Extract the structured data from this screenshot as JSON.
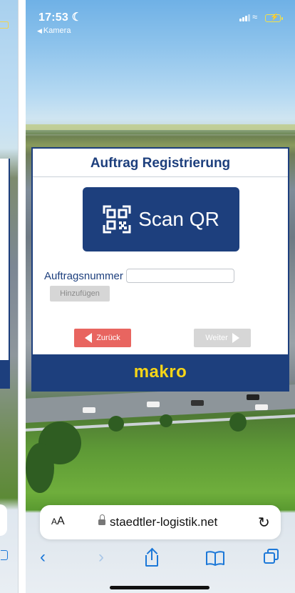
{
  "status_bar": {
    "time": "17:53",
    "back_app": "Kamera"
  },
  "dialog": {
    "title": "Auftrag Registrierung",
    "scan_button_label": "Scan QR",
    "order_number_label": "Auftragsnummer",
    "order_number_value": "",
    "add_button_label": "Hinzufügen",
    "back_button_label": "Zurück",
    "next_button_label": "Weiter",
    "brand": "makro"
  },
  "browser": {
    "text_size_label": "AA",
    "url": "staedtler-logistik.net",
    "icons": {
      "back": "chevron-left-icon",
      "forward": "chevron-right-icon",
      "share": "share-icon",
      "bookmarks": "book-icon",
      "tabs": "tabs-icon",
      "reload": "reload-icon",
      "lock": "lock-icon"
    }
  },
  "colors": {
    "brand_blue": "#1d3f7d",
    "brand_yellow": "#f7d517",
    "back_red": "#e86560",
    "disabled_gray": "#d6d6d6",
    "ios_blue": "#1c78d8"
  }
}
